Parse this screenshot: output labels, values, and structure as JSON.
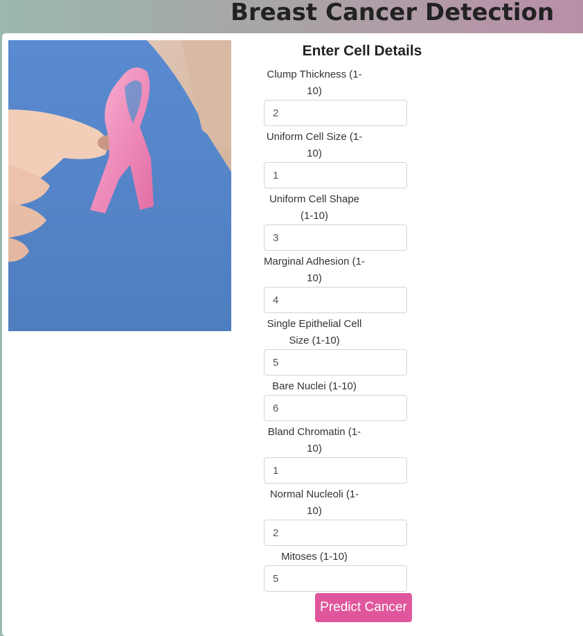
{
  "header": {
    "title": "Breast Cancer Detection"
  },
  "form": {
    "heading": "Enter Cell Details",
    "fields": [
      {
        "label": "Clump Thickness (1-10)",
        "value": "2"
      },
      {
        "label": "Uniform Cell Size (1-10)",
        "value": "1"
      },
      {
        "label": "Uniform Cell Shape (1-10)",
        "value": "3"
      },
      {
        "label": "Marginal Adhesion (1-10)",
        "value": "4"
      },
      {
        "label": "Single Epithelial Cell Size (1-10)",
        "value": "5"
      },
      {
        "label": "Bare Nuclei (1-10)",
        "value": "6"
      },
      {
        "label": "Bland Chromatin (1-10)",
        "value": "1"
      },
      {
        "label": "Normal Nucleoli (1-10)",
        "value": "2"
      },
      {
        "label": "Mitoses (1-10)",
        "value": "5"
      }
    ],
    "submit_label": "Predict Cancer"
  },
  "colors": {
    "button": "#e0569c",
    "ribbon": "#f08fbd",
    "shirt": "#5b87c6"
  }
}
